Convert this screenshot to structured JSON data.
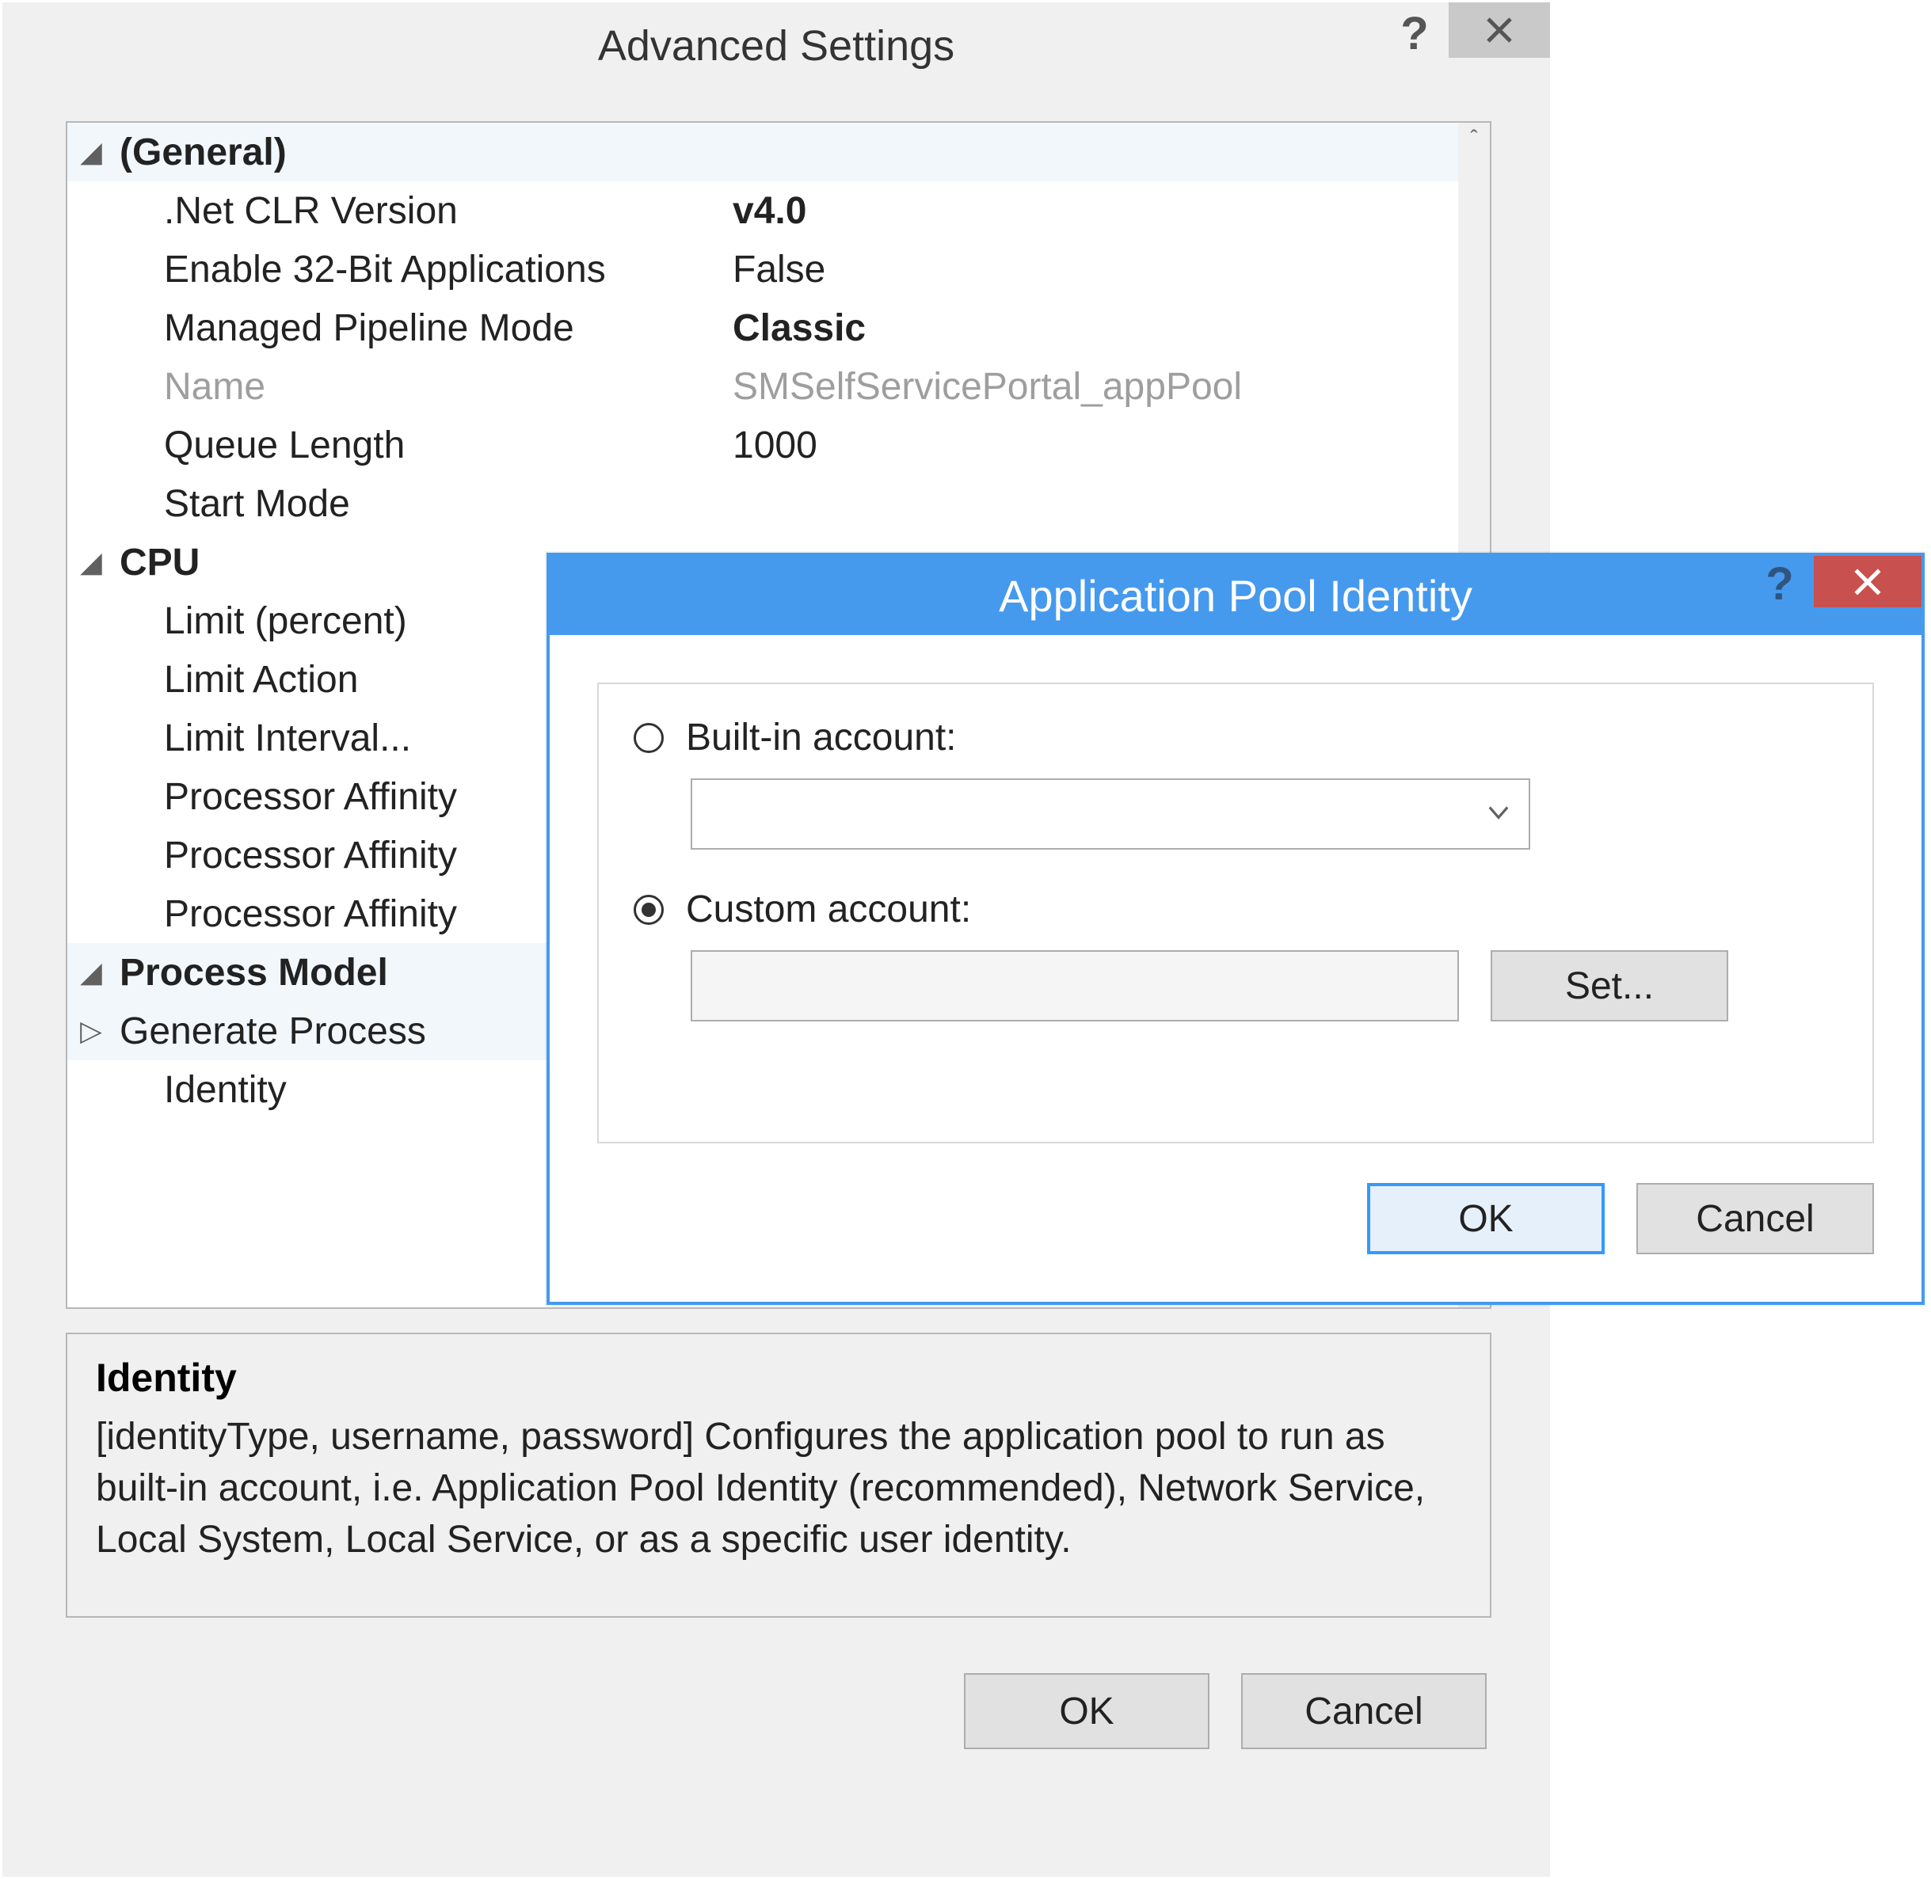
{
  "parent_dialog": {
    "title": "Advanced Settings",
    "sections": {
      "general": {
        "header": "(General)",
        "rows": {
          "clr": {
            "label": ".Net CLR Version",
            "value": "v4.0",
            "bold_value": true
          },
          "enable32": {
            "label": "Enable 32-Bit Applications",
            "value": "False"
          },
          "pipeline": {
            "label": "Managed Pipeline Mode",
            "value": "Classic",
            "bold_value": true
          },
          "name": {
            "label": "Name",
            "value": "SMSelfServicePortal_appPool",
            "grey": true
          },
          "queue": {
            "label": "Queue Length",
            "value": "1000"
          },
          "startmode": {
            "label": "Start Mode",
            "value": ""
          }
        }
      },
      "cpu": {
        "header": "CPU",
        "rows": {
          "limitpct": {
            "label": "Limit (percent)"
          },
          "limitact": {
            "label": "Limit Action"
          },
          "limitint": {
            "label": "Limit Interval..."
          },
          "paff1": {
            "label": "Processor Affinity"
          },
          "paff2": {
            "label": "Processor Affinity"
          },
          "paff3": {
            "label": "Processor Affinity"
          }
        }
      },
      "pm": {
        "header": "Process Model",
        "rows": {
          "genproc": {
            "label": "Generate Process"
          },
          "identity": {
            "label": "Identity"
          }
        }
      }
    },
    "help_panel": {
      "title": "Identity",
      "text": "[identityType, username, password] Configures the application pool to run as built-in account, i.e. Application Pool Identity (recommended), Network Service, Local System, Local Service, or as a specific user identity."
    },
    "buttons": {
      "ok": "OK",
      "cancel": "Cancel"
    }
  },
  "child_dialog": {
    "title": "Application Pool Identity",
    "options": {
      "builtin_label": "Built-in account:",
      "custom_label": "Custom account:",
      "set_button": "Set..."
    },
    "buttons": {
      "ok": "OK",
      "cancel": "Cancel"
    }
  }
}
